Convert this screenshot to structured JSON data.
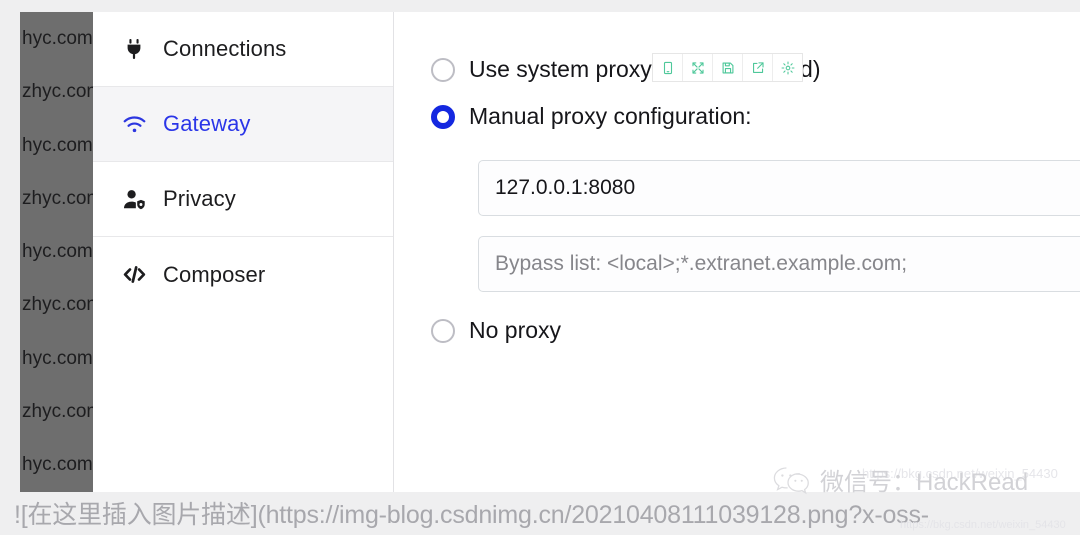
{
  "background_list": {
    "rows": [
      "hyc.com",
      "zhyc.com",
      "hyc.com",
      "zhyc.com",
      "hyc.com",
      "zhyc.com",
      "hyc.com",
      "zhyc.com",
      "hyc.com"
    ]
  },
  "sidebar": {
    "items": [
      {
        "label": "Connections",
        "icon": "plug-icon",
        "active": false
      },
      {
        "label": "Gateway",
        "icon": "wifi-icon",
        "active": true
      },
      {
        "label": "Privacy",
        "icon": "user-shield-icon",
        "active": false
      },
      {
        "label": "Composer",
        "icon": "code-icon",
        "active": false
      }
    ]
  },
  "content": {
    "options": [
      {
        "label": "Use system proxy (recommended)",
        "selected": false
      },
      {
        "label": "Manual proxy configuration:",
        "selected": true
      },
      {
        "label": "No proxy",
        "selected": false
      }
    ],
    "proxy_address": {
      "value": "127.0.0.1:8080",
      "placeholder": "127.0.0.1:8080"
    },
    "bypass_list": {
      "value": "",
      "placeholder": "Bypass list: <local>;*.extranet.example.com;"
    }
  },
  "float_toolbar": {
    "buttons": [
      {
        "name": "device-preview-icon",
        "title": "Device preview"
      },
      {
        "name": "fullscreen-icon",
        "title": "Fullscreen"
      },
      {
        "name": "save-icon",
        "title": "Save"
      },
      {
        "name": "share-icon",
        "title": "Share"
      },
      {
        "name": "gear-icon",
        "title": "Settings"
      }
    ],
    "color": "#4ec89a"
  },
  "watermark": {
    "text": "微信号：HackRead",
    "faint_url": "https://bkg.csdn.net/weixin_54430",
    "faint_url2": "https://bkg.csdn.net/weixin_54430"
  },
  "footer": {
    "text": "![在这里插入图片描述](https://img-blog.csdnimg.cn/20210408111039128.png?x-oss-"
  },
  "colors": {
    "accent_blue": "#2a35e8",
    "radio_blue": "#1428e0",
    "toolbar_green": "#4ec89a",
    "panel_bg": "#ffffff",
    "page_bg": "#efeff0",
    "strip_gray": "#6e6e6e"
  }
}
